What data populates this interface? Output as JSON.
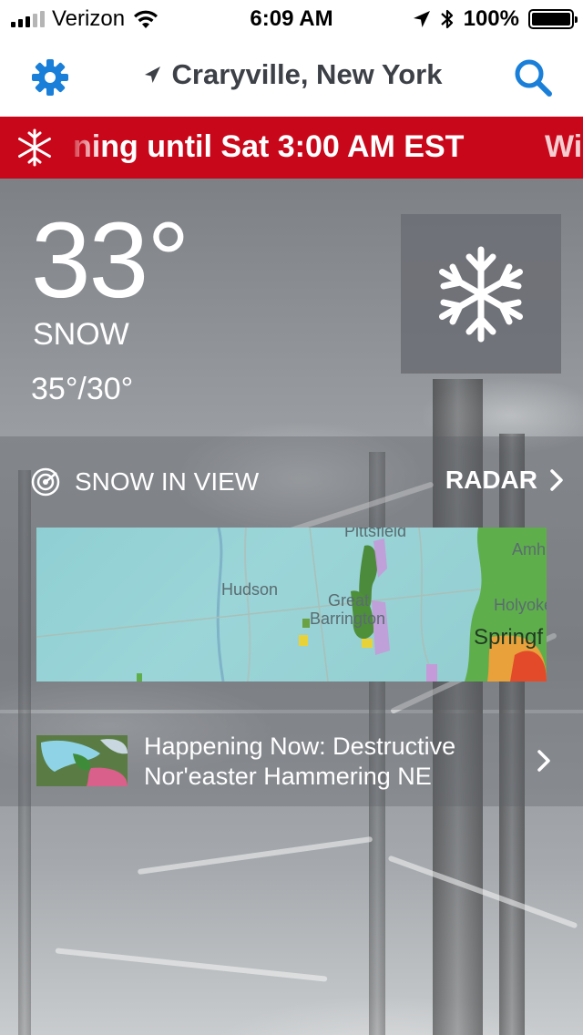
{
  "status_bar": {
    "carrier": "Verizon",
    "time": "6:09 AM",
    "battery": "100%",
    "signal_bars": 5,
    "signal_bars_active": 3
  },
  "nav": {
    "location": "Craryville, New York",
    "settings_icon": "gear-icon",
    "search_icon": "search-icon",
    "location_icon": "location-arrow-icon"
  },
  "alert": {
    "text": "ning until Sat 3:00 AM EST",
    "next_text": "Wi",
    "icon": "snowflake-icon",
    "color": "#c8081a"
  },
  "current": {
    "temperature": "33°",
    "condition": "SNOW",
    "hi_lo": "35°/30°",
    "icon": "snowflake-icon"
  },
  "radar": {
    "title": "SNOW IN VIEW",
    "link_label": "RADAR",
    "map_labels": [
      "Pittsfield",
      "Hudson",
      "Great",
      "Barrington",
      "Holyoke",
      "Springf",
      "Amh"
    ]
  },
  "news": {
    "headline_line1": "Happening Now: Destructive",
    "headline_line2": "Nor'easter Hammering NE"
  },
  "colors": {
    "accent_blue": "#1a7fd8",
    "alert_red": "#c8081a",
    "header_text": "#3d4147"
  }
}
